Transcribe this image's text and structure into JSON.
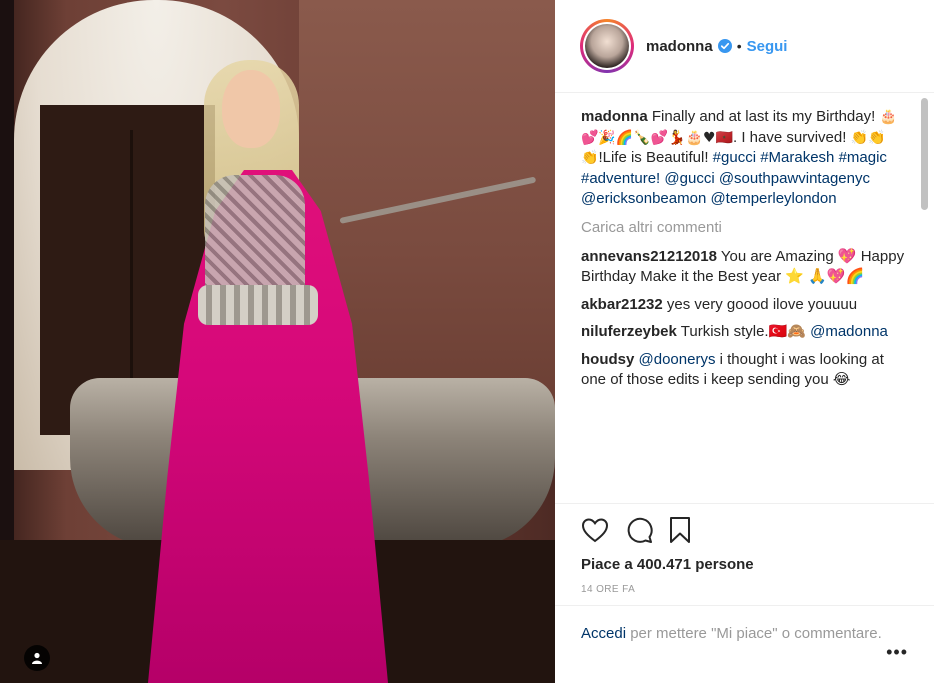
{
  "header": {
    "username": "madonna",
    "follow_label": "Segui",
    "separator": "•"
  },
  "caption": {
    "username": "madonna",
    "text_1": "Finally and at last its my Birthday! ",
    "emojis_1": "🎂💕🎉🌈🍾💕💃🎂♥🇲🇦",
    "text_2": ". I have survived! ",
    "emojis_2": "👏👏👏",
    "text_3": "!Life is Beautiful!",
    "tags": "#gucci #Marakesh #magic #adventure!",
    "mentions": "@gucci @southpawvintagenyc @ericksonbeamon @temperleylondon"
  },
  "load_more": "Carica altri commenti",
  "comments": [
    {
      "username": "annevans21212018",
      "text": "You are Amazing 💖 Happy Birthday Make it the Best year ⭐ 🙏💖🌈"
    },
    {
      "username": "akbar21232",
      "text": "yes very goood ilove youuuu"
    },
    {
      "username": "niluferzeybek",
      "text": "Turkish style.🇹🇷🙈",
      "mention": "@madonna"
    },
    {
      "username": "houdsy",
      "mention": "@doonerys",
      "text": "i thought i was looking at one of those edits i keep sending you 😂"
    }
  ],
  "likes": "Piace a 400.471 persone",
  "time": "14 ORE FA",
  "login": {
    "link": "Accedi",
    "text": "per mettere \"Mi piace\" o commentare.",
    "more": "•••"
  },
  "colors": {
    "accent": "#3897f0",
    "link": "#003569",
    "muted": "#999999",
    "gown": "#d6087a"
  }
}
